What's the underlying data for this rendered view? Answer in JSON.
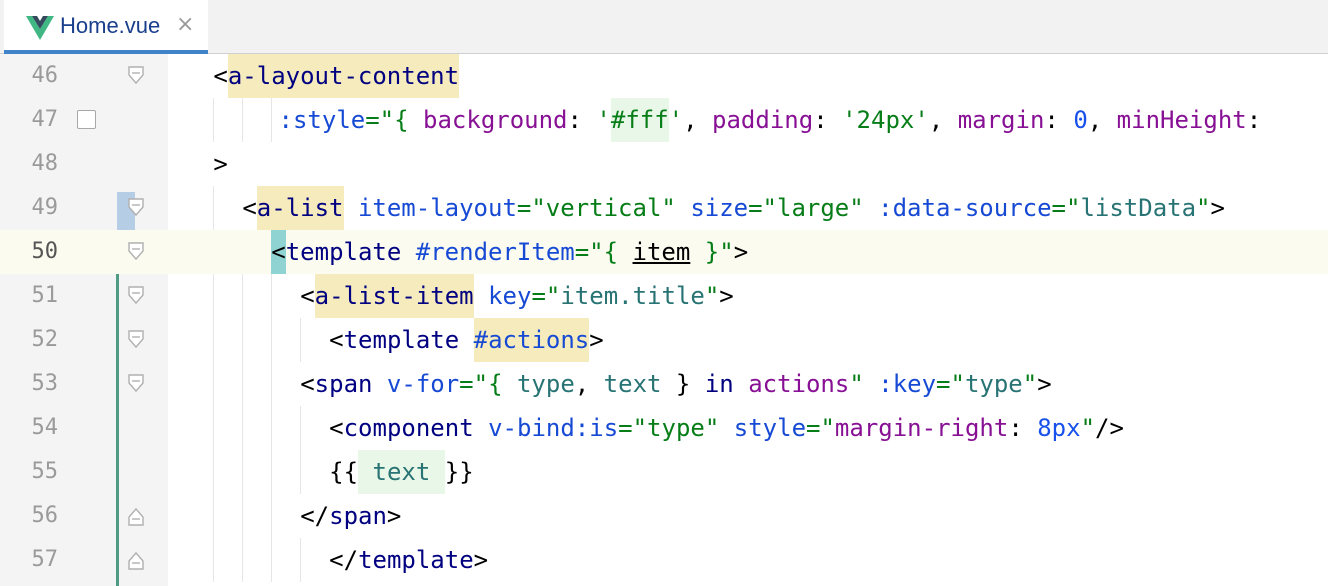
{
  "colors": {
    "tab_accent": "#4083c9",
    "tag_match_highlight": "#f6ebbc",
    "caret_bracket_highlight": "#8fd3d3",
    "identifier_highlight": "#e8f7e8",
    "current_line": "#fbfbf0",
    "vcs_added": "#4f9b84",
    "vcs_modified": "#b6cde6",
    "tag_color": "#000080",
    "attribute_color": "#174ad4",
    "string_color": "#067d17",
    "property_color": "#871094",
    "number_color": "#1750eb",
    "variable_color": "#287373"
  },
  "tab": {
    "icon": "vue-logo-icon",
    "label": "Home.vue",
    "close_icon": "close-icon",
    "close_glyph": "×"
  },
  "gutter": {
    "current_line": "50",
    "lines": [
      {
        "number": "46",
        "fold": "fold-start-icon"
      },
      {
        "number": "47",
        "breakpoint": "breakpoint-checkbox-icon"
      },
      {
        "number": "48"
      },
      {
        "number": "49",
        "fold": "fold-start-icon"
      },
      {
        "number": "50",
        "fold": "fold-start-icon"
      },
      {
        "number": "51",
        "fold": "fold-start-icon"
      },
      {
        "number": "52",
        "fold": "fold-start-icon"
      },
      {
        "number": "53",
        "fold": "fold-start-icon"
      },
      {
        "number": "54"
      },
      {
        "number": "55"
      },
      {
        "number": "56",
        "fold": "fold-end-icon"
      },
      {
        "number": "57",
        "fold": "fold-end-icon"
      }
    ]
  },
  "code_lines": [
    {
      "line": "46",
      "tokens": [
        {
          "t": "<",
          "role": "punct"
        },
        {
          "t": "a-layout-content",
          "role": "tag",
          "hl": "match"
        }
      ]
    },
    {
      "line": "47",
      "tokens": [
        {
          "t": ":style",
          "role": "attr"
        },
        {
          "t": "=\"{ ",
          "role": "string"
        },
        {
          "t": "background",
          "role": "prop"
        },
        {
          "t": ": ",
          "role": "punct"
        },
        {
          "t": "'",
          "role": "string"
        },
        {
          "t": "#fff",
          "role": "string",
          "hl": "ident"
        },
        {
          "t": "'",
          "role": "string"
        },
        {
          "t": ", ",
          "role": "punct"
        },
        {
          "t": "padding",
          "role": "prop"
        },
        {
          "t": ": ",
          "role": "punct"
        },
        {
          "t": "'24px'",
          "role": "string"
        },
        {
          "t": ", ",
          "role": "punct"
        },
        {
          "t": "margin",
          "role": "prop"
        },
        {
          "t": ": ",
          "role": "punct"
        },
        {
          "t": "0",
          "role": "number"
        },
        {
          "t": ", ",
          "role": "punct"
        },
        {
          "t": "minHeight",
          "role": "prop"
        },
        {
          "t": ":",
          "role": "punct"
        }
      ]
    },
    {
      "line": "48",
      "tokens": [
        {
          "t": ">",
          "role": "punct"
        }
      ]
    },
    {
      "line": "49",
      "tokens": [
        {
          "t": "<",
          "role": "punct"
        },
        {
          "t": "a-list",
          "role": "tag",
          "hl": "match"
        },
        {
          "t": " ",
          "role": "punct"
        },
        {
          "t": "item-layout",
          "role": "attr"
        },
        {
          "t": "=\"vertical\"",
          "role": "string"
        },
        {
          "t": " ",
          "role": "punct"
        },
        {
          "t": "size",
          "role": "attr"
        },
        {
          "t": "=\"large\"",
          "role": "string"
        },
        {
          "t": " ",
          "role": "punct"
        },
        {
          "t": ":data-source",
          "role": "attr"
        },
        {
          "t": "=\"",
          "role": "string"
        },
        {
          "t": "listData",
          "role": "variable"
        },
        {
          "t": "\"",
          "role": "string"
        },
        {
          "t": ">",
          "role": "punct"
        }
      ]
    },
    {
      "line": "50",
      "tokens": [
        {
          "t": "<",
          "role": "punct",
          "hl": "caret"
        },
        {
          "t": "template",
          "role": "tag"
        },
        {
          "t": " ",
          "role": "punct"
        },
        {
          "t": "#renderItem",
          "role": "attr"
        },
        {
          "t": "=\"{ ",
          "role": "string"
        },
        {
          "t": "item",
          "role": "punct",
          "underline": true
        },
        {
          "t": " }\"",
          "role": "string"
        },
        {
          "t": ">",
          "role": "punct"
        }
      ]
    },
    {
      "line": "51",
      "tokens": [
        {
          "t": "<",
          "role": "punct"
        },
        {
          "t": "a-list-item",
          "role": "tag",
          "hl": "match"
        },
        {
          "t": " ",
          "role": "punct"
        },
        {
          "t": "key",
          "role": "attr"
        },
        {
          "t": "=\"",
          "role": "string"
        },
        {
          "t": "item.title",
          "role": "variable"
        },
        {
          "t": "\"",
          "role": "string"
        },
        {
          "t": ">",
          "role": "punct"
        }
      ]
    },
    {
      "line": "52",
      "tokens": [
        {
          "t": "<",
          "role": "punct"
        },
        {
          "t": "template",
          "role": "tag"
        },
        {
          "t": " ",
          "role": "punct"
        },
        {
          "t": "#actions",
          "role": "attr",
          "hl": "match"
        },
        {
          "t": ">",
          "role": "punct"
        }
      ]
    },
    {
      "line": "53",
      "tokens": [
        {
          "t": "<",
          "role": "punct"
        },
        {
          "t": "span",
          "role": "tag"
        },
        {
          "t": " ",
          "role": "punct"
        },
        {
          "t": "v-for",
          "role": "attr"
        },
        {
          "t": "=\"{ ",
          "role": "string"
        },
        {
          "t": "type",
          "role": "variable"
        },
        {
          "t": ", ",
          "role": "punct"
        },
        {
          "t": "text",
          "role": "variable"
        },
        {
          "t": " } ",
          "role": "punct"
        },
        {
          "t": "in",
          "role": "tag"
        },
        {
          "t": " ",
          "role": "punct"
        },
        {
          "t": "actions",
          "role": "prop"
        },
        {
          "t": "\"",
          "role": "string"
        },
        {
          "t": " ",
          "role": "punct"
        },
        {
          "t": ":key",
          "role": "attr"
        },
        {
          "t": "=\"",
          "role": "string"
        },
        {
          "t": "type",
          "role": "variable"
        },
        {
          "t": "\"",
          "role": "string"
        },
        {
          "t": ">",
          "role": "punct"
        }
      ]
    },
    {
      "line": "54",
      "tokens": [
        {
          "t": "<",
          "role": "punct"
        },
        {
          "t": "component",
          "role": "tag"
        },
        {
          "t": " ",
          "role": "punct"
        },
        {
          "t": "v-bind:is",
          "role": "attr"
        },
        {
          "t": "=\"type\"",
          "role": "string"
        },
        {
          "t": " ",
          "role": "punct"
        },
        {
          "t": "style",
          "role": "attr"
        },
        {
          "t": "=\"",
          "role": "string"
        },
        {
          "t": "margin-right",
          "role": "prop"
        },
        {
          "t": ": ",
          "role": "punct"
        },
        {
          "t": "8px",
          "role": "number"
        },
        {
          "t": "\"",
          "role": "string"
        },
        {
          "t": "/>",
          "role": "punct"
        }
      ]
    },
    {
      "line": "55",
      "tokens": [
        {
          "t": "{{",
          "role": "punct"
        },
        {
          "t": " text ",
          "role": "variable",
          "hl": "ident"
        },
        {
          "t": "}}",
          "role": "punct"
        }
      ]
    },
    {
      "line": "56",
      "tokens": [
        {
          "t": "</",
          "role": "punct"
        },
        {
          "t": "span",
          "role": "tag"
        },
        {
          "t": ">",
          "role": "punct"
        }
      ]
    },
    {
      "line": "57",
      "tokens": [
        {
          "t": "</",
          "role": "punct"
        },
        {
          "t": "template",
          "role": "tag"
        },
        {
          "t": ">",
          "role": "punct"
        }
      ]
    }
  ]
}
